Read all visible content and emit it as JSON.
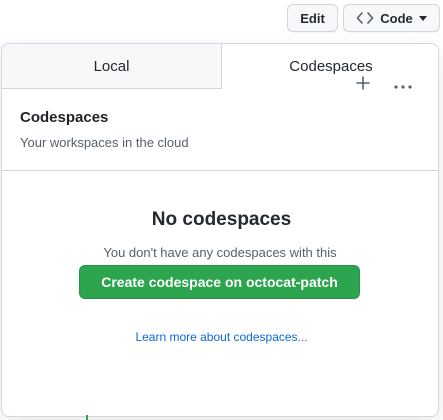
{
  "topbar": {
    "edit_label": "Edit",
    "code_label": "Code",
    "code_icon": "code-brackets-icon",
    "caret_icon": "caret-down-icon"
  },
  "tabs": [
    {
      "label": "Local",
      "selected": false
    },
    {
      "label": "Codespaces",
      "selected": true
    }
  ],
  "codespaces": {
    "title": "Codespaces",
    "subtitle": "Your workspaces in the cloud",
    "add_icon": "plus-icon",
    "more_icon": "kebab-horizontal-icon"
  },
  "empty_state": {
    "title": "No codespaces",
    "description": "You don't have any codespaces with this repository checked out",
    "create_button_label": "Create codespace on octocat-patch",
    "learn_more_link": "Learn more about codespaces..."
  },
  "colors": {
    "primary_button": "#2da44e",
    "link": "#0969da",
    "border": "#d0d7de"
  }
}
